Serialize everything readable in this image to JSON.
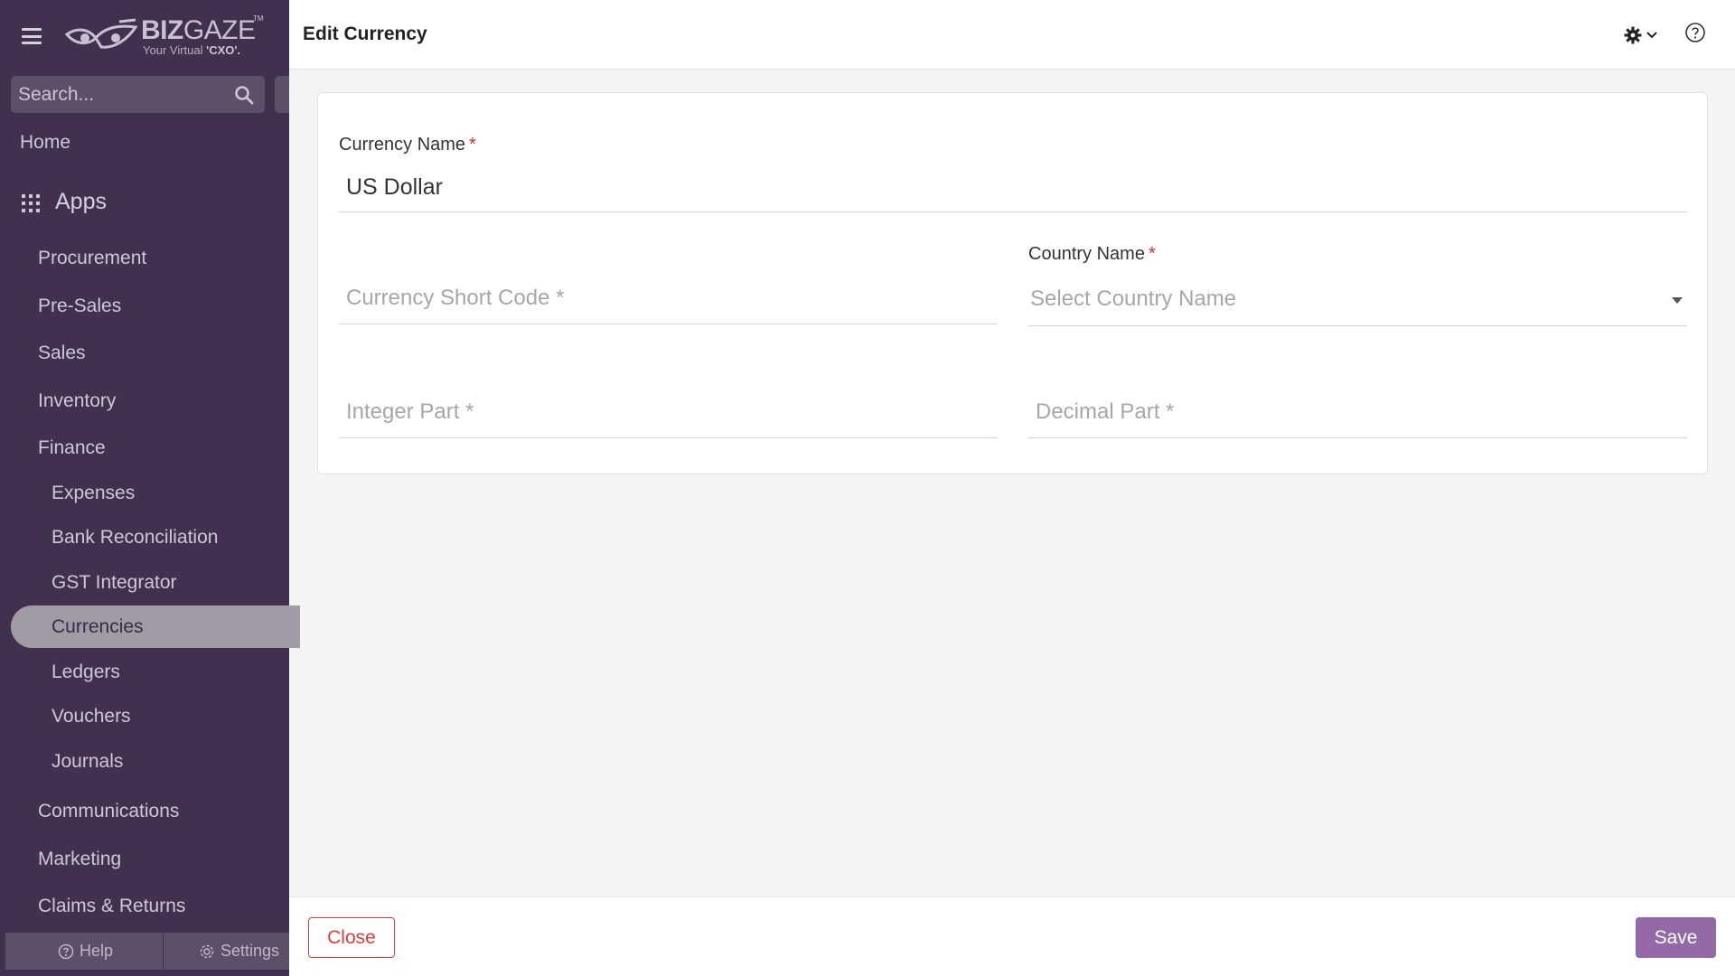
{
  "brand": {
    "name_bold": "BIZ",
    "name_light": "GAZE",
    "trademark": "TM",
    "tagline_prefix": "Your Virtual ",
    "tagline_bold": "'CXO'."
  },
  "search": {
    "placeholder": "Search..."
  },
  "sidebar": {
    "home": "Home",
    "apps": "Apps",
    "items": [
      "Procurement",
      "Pre-Sales",
      "Sales",
      "Inventory",
      "Finance",
      "Expenses",
      "Bank Reconciliation",
      "GST Integrator",
      "Currencies",
      "Ledgers",
      "Vouchers",
      "Journals",
      "Communications",
      "Marketing",
      "Claims & Returns"
    ],
    "active_item": "Currencies",
    "footer": {
      "help": "Help",
      "settings": "Settings"
    }
  },
  "header": {
    "title": "Edit Currency"
  },
  "form": {
    "currency_name": {
      "label": "Currency Name",
      "required_mark": "*",
      "value": "US Dollar"
    },
    "currency_short_code": {
      "placeholder": "Currency Short Code *"
    },
    "country_name": {
      "label": "Country Name",
      "required_mark": "*",
      "placeholder": "Select Country Name"
    },
    "integer_part": {
      "placeholder": "Integer Part *"
    },
    "decimal_part": {
      "placeholder": "Decimal Part *"
    }
  },
  "actions": {
    "close": "Close",
    "save": "Save"
  },
  "colors": {
    "sidebar_bg": "#41304e",
    "active_item_bg": "#a09ba5",
    "required": "#e0262e",
    "close_button": "#e03b3b",
    "save_button": "#936aa7"
  }
}
